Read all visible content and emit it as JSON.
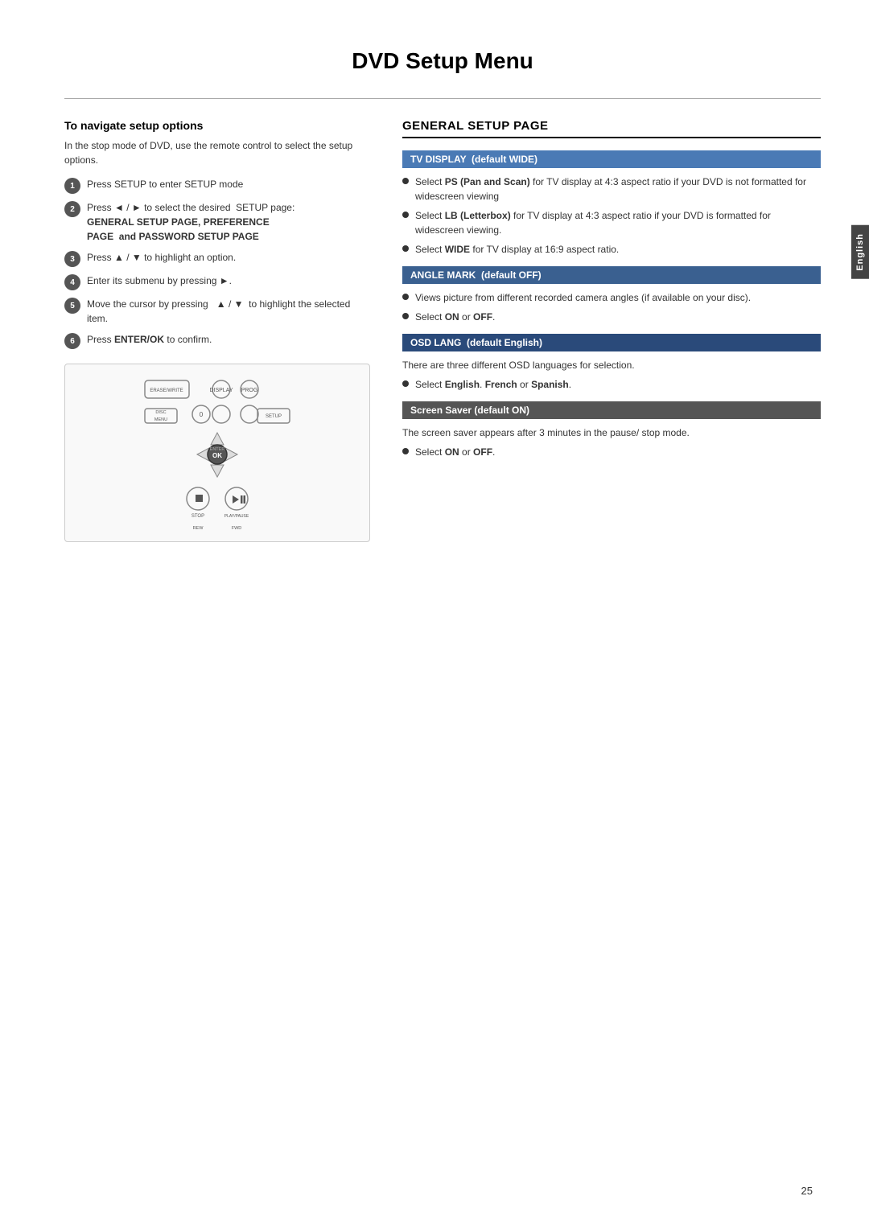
{
  "page": {
    "title": "DVD Setup Menu",
    "page_number": "25",
    "lang_tab": "English"
  },
  "left_section": {
    "heading": "To navigate setup options",
    "intro_lines": [
      "In the stop mode of DVD, use the remote",
      "control to select the setup options."
    ],
    "steps": [
      {
        "num": "1",
        "text": "Press SETUP to enter SETUP mode"
      },
      {
        "num": "2",
        "text": "Press ◄ / ► to select the desired  SETUP page: GENERAL SETUP PAGE, PREFERENCE PAGE  and PASSWORD SETUP PAGE",
        "bold_parts": [
          "GENERAL SETUP PAGE, PREFERENCE PAGE  and PASSWORD SETUP PAGE"
        ]
      },
      {
        "num": "3",
        "text": "Press ▲ / ▼ to highlight an option."
      },
      {
        "num": "4",
        "text": "Enter its submenu by pressing ►."
      },
      {
        "num": "5",
        "text": "Move the cursor by pressing  ▲ / ▼  to highlight the selected item."
      },
      {
        "num": "6",
        "text": "Press ENTER/OK to confirm.",
        "bold_word": "ENTER/OK"
      }
    ]
  },
  "right_section": {
    "title": "GENERAL SETUP PAGE",
    "subsections": [
      {
        "bar_label": "TV DISPLAY  (default WIDE)",
        "items": [
          {
            "text_before": "Select ",
            "bold": "PS (Pan and Scan)",
            "text_after": " for TV display at 4:3 aspect ratio if your DVD is not formatted for widescreen viewing"
          },
          {
            "text_before": "Select ",
            "bold": "LB (Letterbox)",
            "text_after": " for TV display at 4:3 aspect ratio if your DVD is formatted for widescreen viewing."
          },
          {
            "text_before": "Select ",
            "bold": "WIDE",
            "text_after": " for TV display at 16:9 aspect ratio."
          }
        ]
      },
      {
        "bar_label": "ANGLE MARK  (default OFF)",
        "desc": null,
        "items": [
          {
            "text_before": "Views picture from different recorded camera angles (if available on your disc).",
            "bold": null,
            "text_after": null
          },
          {
            "text_before": "Select ",
            "bold": "ON",
            "text_middle": " or ",
            "bold2": "OFF",
            "text_after": "."
          }
        ]
      },
      {
        "bar_label": "OSD LANG  (default English)",
        "desc": "There are three different OSD languages for selection.",
        "items": [
          {
            "text_before": "Select ",
            "bold": "English",
            "text_middle": ". ",
            "bold2": "French",
            "text_middle2": " or ",
            "bold3": "Spanish",
            "text_after": "."
          }
        ]
      },
      {
        "bar_label": "Screen Saver (default ON)",
        "bar_style": "screen-saver",
        "desc": "The screen saver appears after 3 minutes in the pause/ stop mode.",
        "items": [
          {
            "text_before": "Select ",
            "bold": "ON",
            "text_middle": " or ",
            "bold2": "OFF",
            "text_after": "."
          }
        ]
      }
    ]
  },
  "remote": {
    "labels": {
      "erase_write": "ERASE/WRITE",
      "display": "DISPLAY",
      "prog": "PROG",
      "zero": "0",
      "disc": "DISC",
      "menu": "MENU",
      "setup": "SETUP",
      "enter": "ENTER",
      "ok": "OK",
      "stop": "STOP",
      "play_pause": "PLAY/PAUSE",
      "rew": "REW",
      "fwd": "FWD"
    }
  }
}
